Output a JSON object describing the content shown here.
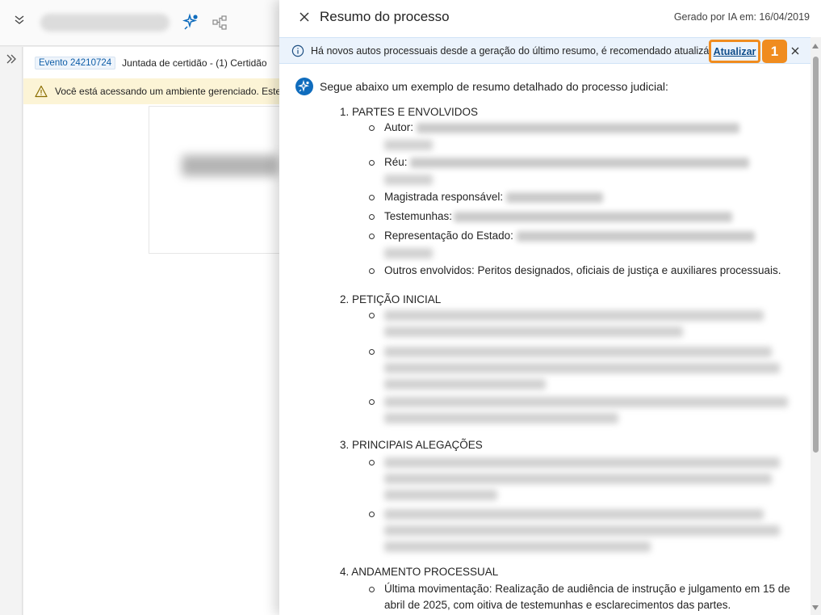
{
  "background": {
    "event_tag": "Evento 24210724",
    "event_text": "Juntada de certidão - (1) Certidão",
    "warning_text": "Você está acessando um ambiente gerenciado. Este"
  },
  "panel": {
    "title": "Resumo do processo",
    "generated_meta": "Gerado por IA em: 16/04/2019",
    "info_message": "Há novos autos processuais desde a geração do último resumo, é recomendado atualizá-lo",
    "update_link": "Atualizar",
    "step_badge": "1",
    "intro": "Segue abaixo um exemplo de resumo detalhado do processo judicial:",
    "sections": [
      {
        "heading": "1. PARTES E ENVOLVIDOS",
        "items": [
          {
            "label": "Autor:"
          },
          {
            "label": "Réu:"
          },
          {
            "label": "Magistrada responsável:"
          },
          {
            "label": "Testemunhas:"
          },
          {
            "label": "Representação do Estado:"
          },
          {
            "label": "Outros envolvidos: Peritos designados, oficiais de justiça e auxiliares processuais."
          }
        ]
      },
      {
        "heading": "2. PETIÇÃO INICIAL"
      },
      {
        "heading": "3. PRINCIPAIS ALEGAÇÕES"
      },
      {
        "heading": "4. ANDAMENTO PROCESSUAL",
        "items": [
          {
            "label": "Última movimentação: Realização de audiência de instrução e julgamento em 15 de abril de 2025, com oitiva de testemunhas e esclarecimentos das partes."
          }
        ]
      }
    ]
  },
  "colors": {
    "accent_blue": "#0f6cbd",
    "callout_orange": "#f08c1f",
    "info_bg": "#ebf3fc",
    "warning_bg": "#fcf4d6"
  }
}
